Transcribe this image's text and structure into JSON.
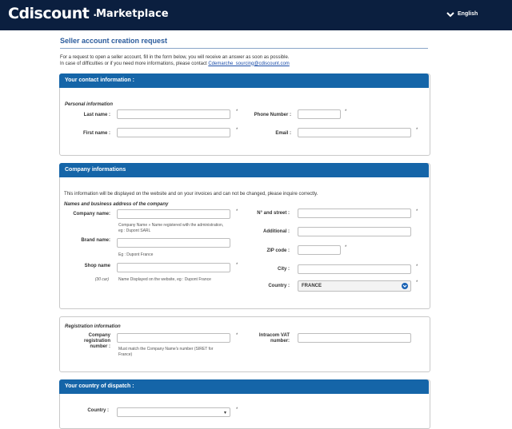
{
  "header": {
    "logo": "Cdiscount",
    "separator": "·",
    "subtitle": "Marketplace",
    "language": "English"
  },
  "page": {
    "title": "Seller account creation request",
    "intro_line1": "For a request to open a seller account, fill in the form below, you will receive an answer as soon as possible.",
    "intro_line2": "In case of difficulties or if you need more informations, please contact ",
    "contact_email": "Cdemarche_sourcing@cdiscount.com"
  },
  "contact": {
    "heading": "Your contact information :",
    "section": "Personal information",
    "last_name": "Last name :",
    "first_name": "First name :",
    "phone": "Phone Number :",
    "email": "Email :"
  },
  "company": {
    "heading": "Company informations",
    "note": "This information will be displayed on the website and on your invoices and can not be changed, please inquire correctly.",
    "section": "Names and business address of the company",
    "company_name": "Company name:",
    "company_name_hint1": "Company Name » Name registered with the administration,",
    "company_name_hint2": "eg : Dupont SARL",
    "brand_name": "Brand name:",
    "brand_name_hint": "Eg : Dupont France",
    "shop_name": "Shop name",
    "shop_name_counter": "(30 car)",
    "shop_name_hint": "Name Displayed on the website, eg : Dupont France",
    "street": "N° and street :",
    "additional": "Additional :",
    "zip": "ZIP code :",
    "city": "City :",
    "country": "Country :",
    "country_value": "FRANCE"
  },
  "registration": {
    "section": "Registration information",
    "company_reg_1": "Company",
    "company_reg_2": "registration",
    "company_reg_3": "number :",
    "company_reg_hint1": "Must match the Company Name's number (SIRET for",
    "company_reg_hint2": "France)",
    "vat_1": "Intracom VAT",
    "vat_2": "number:"
  },
  "dispatch": {
    "heading": "Your country of dispatch :",
    "country": "Country :",
    "arrow": "▼"
  },
  "required_mark": "*",
  "colors": {
    "header_bg": "#0b1f3f",
    "panel_head": "#1565a8",
    "title": "#2a5b9c",
    "link": "#1a4ca8"
  }
}
